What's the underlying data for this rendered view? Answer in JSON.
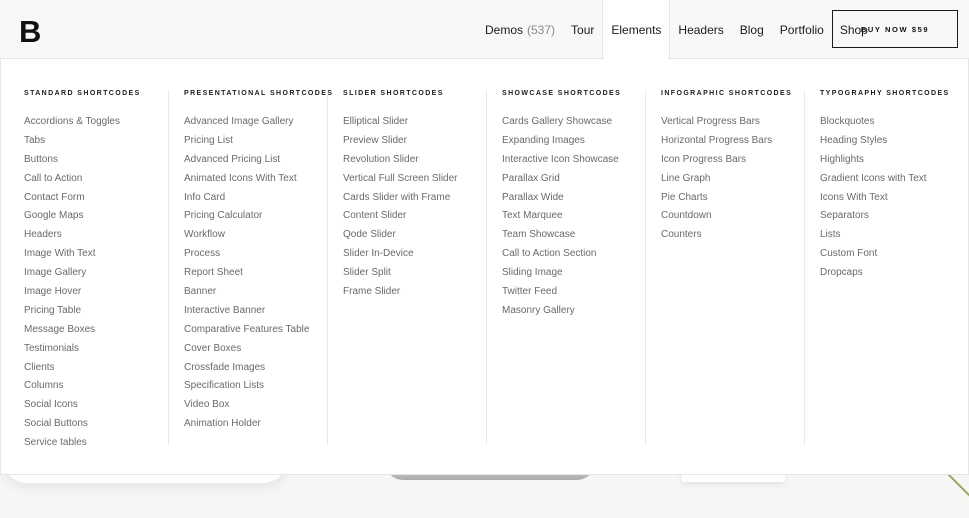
{
  "logo": "B",
  "nav": {
    "demos_label": "Demos",
    "demos_count": "(537)",
    "tour": "Tour",
    "elements": "Elements",
    "headers": "Headers",
    "blog": "Blog",
    "portfolio": "Portfolio",
    "shop": "Shop"
  },
  "buy_button": "BUY NOW $59",
  "menu": {
    "columns": [
      {
        "title": "Standard Shortcodes",
        "items": [
          "Accordions & Toggles",
          "Tabs",
          "Buttons",
          "Call to Action",
          "Contact Form",
          "Google Maps",
          "Headers",
          "Image With Text",
          "Image Gallery",
          "Image Hover",
          "Pricing Table",
          "Message Boxes",
          "Testimonials",
          "Clients",
          "Columns",
          "Social Icons",
          "Social Buttons",
          "Service tables"
        ]
      },
      {
        "title": "Presentational Shortcodes",
        "items": [
          "Advanced Image Gallery",
          "Pricing List",
          "Advanced Pricing List",
          "Animated Icons With Text",
          "Info Card",
          "Pricing Calculator",
          "Workflow",
          "Process",
          "Report Sheet",
          "Banner",
          "Interactive Banner",
          "Comparative Features Table",
          "Cover Boxes",
          "Crossfade Images",
          "Specification Lists",
          "Video Box",
          "Animation Holder"
        ]
      },
      {
        "title": "Slider Shortcodes",
        "items": [
          "Elliptical Slider",
          "Preview Slider",
          "Revolution Slider",
          "Vertical Full Screen Slider",
          "Cards Slider with Frame",
          "Content Slider",
          "Qode Slider",
          "Slider In-Device",
          "Slider Split",
          "Frame Slider"
        ]
      },
      {
        "title": "Showcase Shortcodes",
        "items": [
          "Cards Gallery Showcase",
          "Expanding Images",
          "Interactive Icon Showcase",
          "Parallax Grid",
          "Parallax Wide",
          "Text Marquee",
          "Team Showcase",
          "Call to Action Section",
          "Sliding Image",
          "Twitter Feed",
          "Masonry Gallery"
        ]
      },
      {
        "title": "Infographic Shortcodes",
        "items": [
          "Vertical Progress Bars",
          "Horizontal Progress Bars",
          "Icon Progress Bars",
          "Line Graph",
          "Pie Charts",
          "Countdown",
          "Counters"
        ]
      },
      {
        "title": "Typography Shortcodes",
        "items": [
          "Blockquotes",
          "Heading Styles",
          "Highlights",
          "Gradient Icons with Text",
          "Icons With Text",
          "Separators",
          "Lists",
          "Custom Font",
          "Dropcaps"
        ]
      }
    ]
  }
}
